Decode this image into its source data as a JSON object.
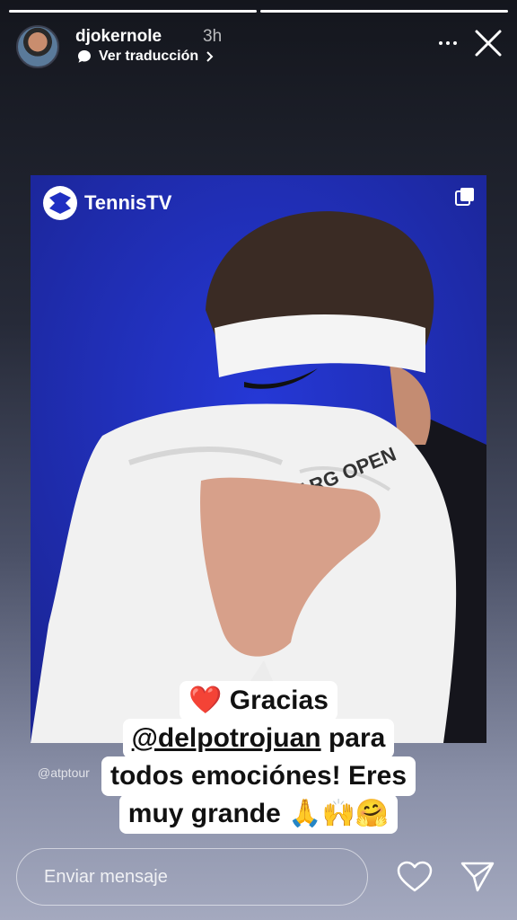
{
  "story": {
    "progress_segments": [
      1.0,
      1.0
    ],
    "username": "djokernole",
    "time": "3h",
    "translate_label": "Ver traducción",
    "more_icon": "more-dots-icon",
    "close_icon": "close-icon"
  },
  "media": {
    "logo_text": "TennisTV",
    "credit": "@atptour",
    "background_color": "#1f2fc2"
  },
  "caption": {
    "line1_emoji": "❤️",
    "line1_text": "Gracias",
    "line2_mention": "@delpotrojuan",
    "line2_text": "para",
    "line3": "todos emociónes! Eres",
    "line4_text": "muy grande",
    "line4_emoji": "🙏🙌🤗"
  },
  "footer": {
    "message_placeholder": "Enviar mensaje",
    "heart_icon": "heart-icon",
    "send_icon": "send-icon"
  }
}
